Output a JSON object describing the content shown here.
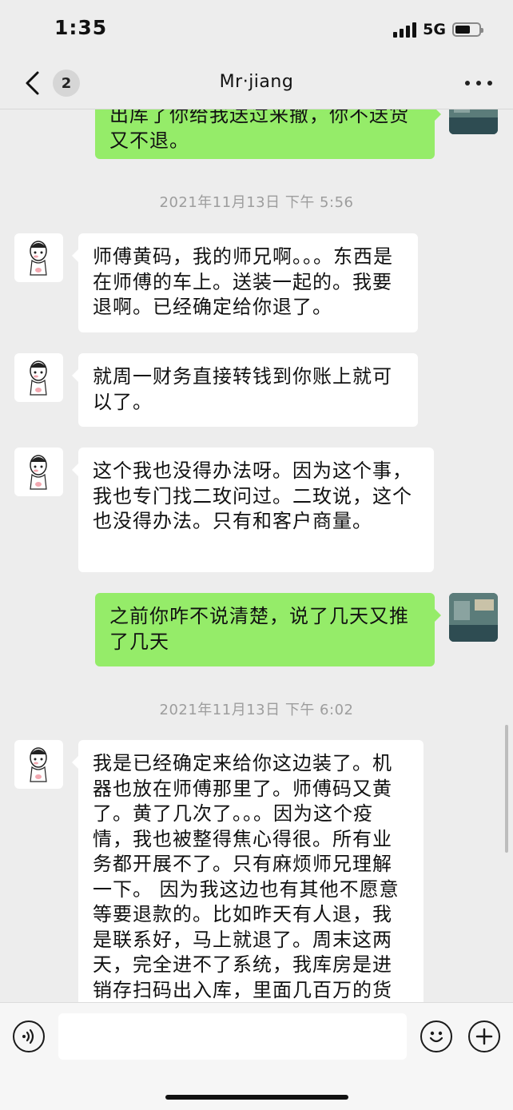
{
  "status_bar": {
    "time": "1:35",
    "network": "5G",
    "battery_level": 0.65
  },
  "header": {
    "back_badge": "2",
    "title": "Mr·jiang",
    "more_icon": "more-dots-icon"
  },
  "messages": [
    {
      "type": "out",
      "text": "出库了你给我送过来撤，你不送货又不退。"
    },
    {
      "type": "time",
      "text": "2021年11月13日 下午 5:56"
    },
    {
      "type": "in",
      "text": "师傅黄码，我的师兄啊。。。东西是在师傅的车上。送装一起的。我要退啊。已经确定给你退了。"
    },
    {
      "type": "in",
      "text": "就周一财务直接转钱到你账上就可以了。"
    },
    {
      "type": "in",
      "text": "这个我也没得办法呀。因为这个事，我也专门找二玫问过。二玫说，这个也没得办法。只有和客户商量。"
    },
    {
      "type": "out",
      "text": "之前你咋不说清楚，说了几天又推了几天"
    },
    {
      "type": "time",
      "text": "2021年11月13日 下午 6:02"
    },
    {
      "type": "in",
      "text": "我是已经确定来给你这边装了。机器也放在师傅那里了。师傅码又黄了。黄了几次了。。。因为这个疫情，我也被整得焦心得很。所有业务都开展不了。只有麻烦师兄理解一下。 因为我这边也有其他不愿意等要退款的。比如昨天有人退，我是联系好，马上就退了。周末这两天，完全进不了系统，我库房是进销存扫码出入库，里面几百万的货"
    }
  ],
  "input_bar": {
    "voice_icon": "voice-icon",
    "input_value": "",
    "emoji_icon": "emoji-icon",
    "plus_icon": "plus-icon"
  },
  "colors": {
    "background": "#ededed",
    "outgoing_bubble": "#95ec69",
    "incoming_bubble": "#ffffff",
    "timestamp": "#9d9d9d"
  }
}
